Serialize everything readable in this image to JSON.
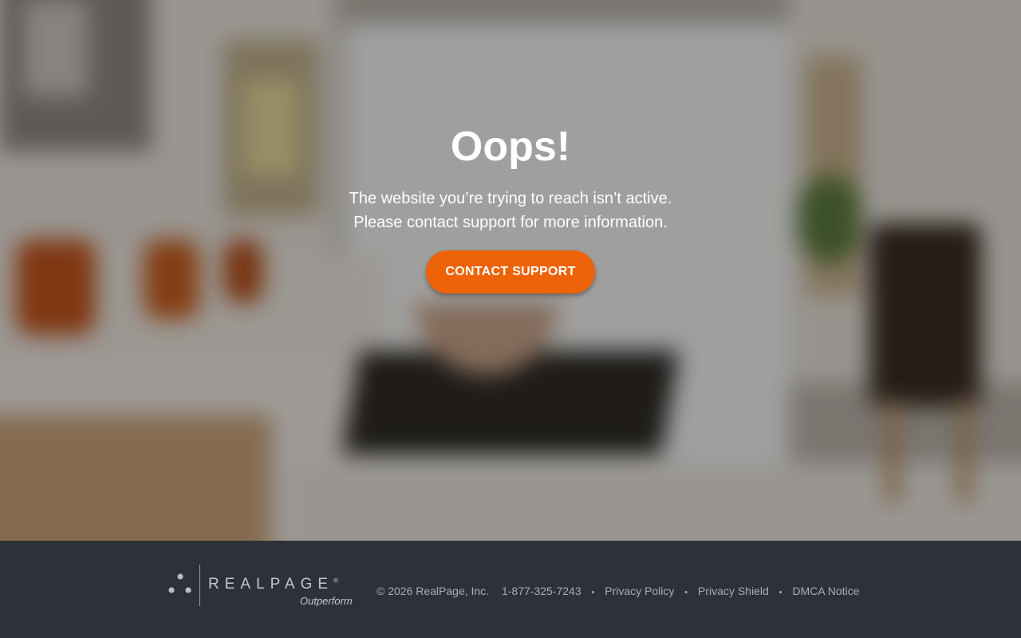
{
  "hero": {
    "title": "Oops!",
    "message_line1": "The website you’re trying to reach isn’t active.",
    "message_line2": "Please contact support for more information.",
    "cta_label": "CONTACT SUPPORT"
  },
  "footer": {
    "logo": {
      "wordmark": "REALPAGE",
      "registered_mark": "®",
      "tagline": "Outperform"
    },
    "copyright": "© 2026 RealPage, Inc.",
    "phone": "1-877-325-7243",
    "separator": "•",
    "links": [
      {
        "label": "Privacy Policy"
      },
      {
        "label": "Privacy Shield"
      },
      {
        "label": "DMCA Notice"
      }
    ]
  },
  "colors": {
    "accent": "#ee6208",
    "footer_bg": "#2e3238",
    "text_primary": "#ffffff",
    "footer_text": "#a9adb2"
  }
}
